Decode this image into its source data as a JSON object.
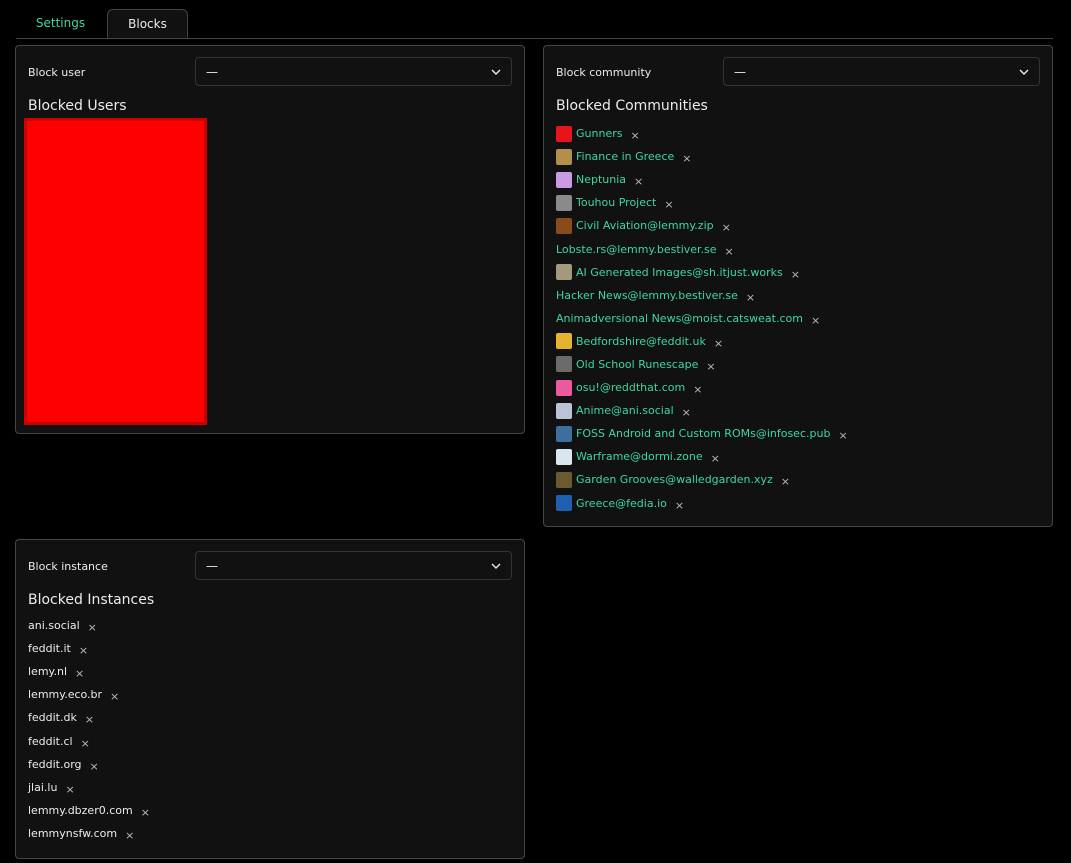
{
  "tabs": [
    {
      "label": "Settings"
    },
    {
      "label": "Blocks"
    }
  ],
  "block_user": {
    "label": "Block user",
    "selected": "—",
    "list_title": "Blocked Users"
  },
  "block_community": {
    "label": "Block community",
    "selected": "—",
    "list_title": "Blocked Communities",
    "items": [
      {
        "name": "Gunners",
        "icon_color": "#e8141c",
        "has_icon": true
      },
      {
        "name": "Finance in Greece",
        "icon_color": "#b38f4c",
        "has_icon": true
      },
      {
        "name": "Neptunia",
        "icon_color": "#c89be3",
        "has_icon": true
      },
      {
        "name": "Touhou Project",
        "icon_color": "#8a8a8a",
        "has_icon": true
      },
      {
        "name": "Civil Aviation@lemmy.zip",
        "icon_color": "#8a4a1c",
        "has_icon": true
      },
      {
        "name": "Lobste.rs@lemmy.bestiver.se",
        "icon_color": "",
        "has_icon": false
      },
      {
        "name": "AI Generated Images@sh.itjust.works",
        "icon_color": "#a39a7e",
        "has_icon": true
      },
      {
        "name": "Hacker News@lemmy.bestiver.se",
        "icon_color": "",
        "has_icon": false
      },
      {
        "name": "Animadversional News@moist.catsweat.com",
        "icon_color": "",
        "has_icon": false
      },
      {
        "name": "Bedfordshire@feddit.uk",
        "icon_color": "#e6b32e",
        "has_icon": true
      },
      {
        "name": "Old School Runescape",
        "icon_color": "#6b6b6b",
        "has_icon": true
      },
      {
        "name": "osu!@reddthat.com",
        "icon_color": "#ea5a9c",
        "has_icon": true
      },
      {
        "name": "Anime@ani.social",
        "icon_color": "#b9c4d6",
        "has_icon": true
      },
      {
        "name": "FOSS Android and Custom ROMs@infosec.pub",
        "icon_color": "#3b6f9e",
        "has_icon": true
      },
      {
        "name": "Warframe@dormi.zone",
        "icon_color": "#d9e6ef",
        "has_icon": true
      },
      {
        "name": "Garden Grooves@walledgarden.xyz",
        "icon_color": "#6b5a2e",
        "has_icon": true
      },
      {
        "name": "Greece@fedia.io",
        "icon_color": "#1f5fb0",
        "has_icon": true
      }
    ]
  },
  "block_instance": {
    "label": "Block instance",
    "selected": "—",
    "list_title": "Blocked Instances",
    "items": [
      {
        "name": "ani.social"
      },
      {
        "name": "feddit.it"
      },
      {
        "name": "lemy.nl"
      },
      {
        "name": "lemmy.eco.br"
      },
      {
        "name": "feddit.dk"
      },
      {
        "name": "feddit.cl"
      },
      {
        "name": "feddit.org"
      },
      {
        "name": "jlai.lu"
      },
      {
        "name": "lemmy.dbzer0.com"
      },
      {
        "name": "lemmynsfw.com"
      }
    ]
  },
  "remove_glyph": "×",
  "colors": {
    "accent": "#3dd6a8",
    "redaction": "#ff0000"
  }
}
